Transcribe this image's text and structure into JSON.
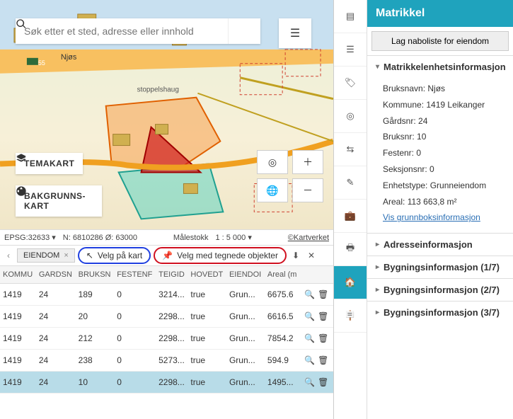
{
  "search": {
    "placeholder": "Søk etter et sted, adresse eller innhold"
  },
  "map": {
    "labels": {
      "njos": "Njøs",
      "ctr": "stoppelshaug"
    },
    "layerbtns": {
      "tema": "TEMAKART",
      "bakk": "BAKGRUNNS-KART"
    }
  },
  "statusbar": {
    "epsg": "EPSG:32633 ▾",
    "coords": "N: 6810286 Ø: 63000",
    "scale_label": "Målestokk",
    "scale_value": "1 : 5 000 ▾",
    "attribution": "©Kartverket"
  },
  "tabs": {
    "name": "EIENDOM"
  },
  "toolbar": {
    "velg_kart": "Velg på kart",
    "velg_tegn": "Velg med tegnede objekter"
  },
  "columns": [
    "KOMMU",
    "GARDSN",
    "BRUKSN",
    "FESTENF",
    "TEIGID",
    "HOVEDT",
    "EIENDOI",
    "Areal (m"
  ],
  "rows": [
    {
      "kommu": "1419",
      "gard": "24",
      "bruk": "189",
      "fest": "0",
      "teig": "3214...",
      "hoved": "true",
      "eien": "Grun...",
      "areal": "6675.6"
    },
    {
      "kommu": "1419",
      "gard": "24",
      "bruk": "20",
      "fest": "0",
      "teig": "2298...",
      "hoved": "true",
      "eien": "Grun...",
      "areal": "6616.5"
    },
    {
      "kommu": "1419",
      "gard": "24",
      "bruk": "212",
      "fest": "0",
      "teig": "2298...",
      "hoved": "true",
      "eien": "Grun...",
      "areal": "7854.2"
    },
    {
      "kommu": "1419",
      "gard": "24",
      "bruk": "238",
      "fest": "0",
      "teig": "5273...",
      "hoved": "true",
      "eien": "Grun...",
      "areal": "594.9"
    },
    {
      "kommu": "1419",
      "gard": "24",
      "bruk": "10",
      "fest": "0",
      "teig": "2298...",
      "hoved": "true",
      "eien": "Grun...",
      "areal": "1495..."
    }
  ],
  "panel": {
    "title": "Matrikkel",
    "naboliste": "Lag naboliste for eiendom",
    "sect_main": "Matrikkelenhetsinformasjon",
    "bruksnavn_l": "Bruksnavn:",
    "bruksnavn_v": "Njøs",
    "kommune_l": "Kommune:",
    "kommune_v": "1419 Leikanger",
    "gardsnr_l": "Gårdsnr:",
    "gardsnr_v": "24",
    "bruksnr_l": "Bruksnr:",
    "bruksnr_v": "10",
    "festenr_l": "Festenr:",
    "festenr_v": "0",
    "seksj_l": "Seksjonsnr:",
    "seksj_v": "0",
    "enhet_l": "Enhetstype:",
    "enhet_v": "Grunneiendom",
    "areal_l": "Areal:",
    "areal_v": "113 663,8 m²",
    "grunnbok": "Vis grunnboksinformasjon",
    "sect_adr": "Adresseinformasjon",
    "sect_byg1": "Bygningsinformasjon (1/7)",
    "sect_byg2": "Bygningsinformasjon (2/7)",
    "sect_byg3": "Bygningsinformasjon (3/7)"
  }
}
